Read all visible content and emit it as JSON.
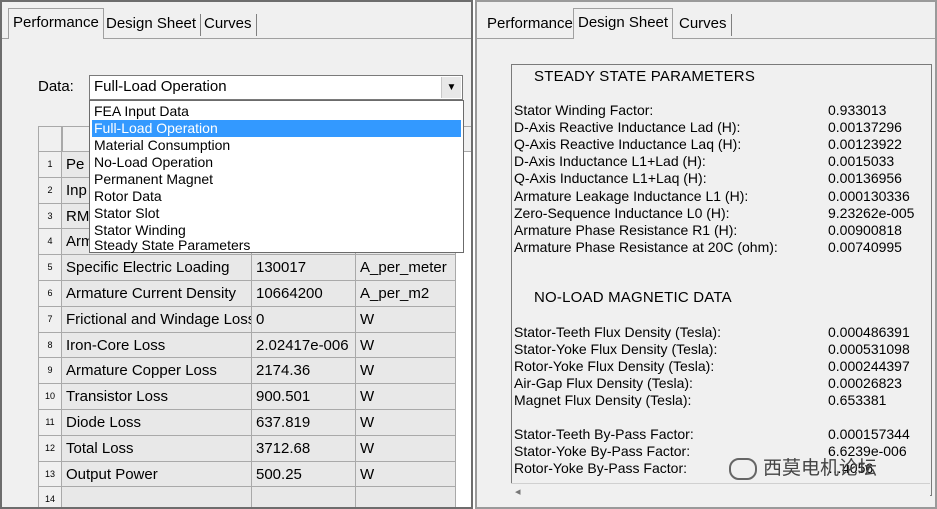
{
  "left": {
    "tabs": [
      "Performance",
      "Design Sheet",
      "Curves"
    ],
    "data_label": "Data:",
    "selected": "Full-Load Operation",
    "dropdown_options": [
      "FEA Input Data",
      "Full-Load Operation",
      "Material Consumption",
      "No-Load Operation",
      "Permanent Magnet",
      "Rotor Data",
      "Stator Slot",
      "Stator Winding",
      "Steady State Parameters"
    ],
    "hidden_rows": [
      {
        "num": "1",
        "name": "Pe"
      },
      {
        "num": "2",
        "name": "Inp"
      },
      {
        "num": "3",
        "name": "RM"
      },
      {
        "num": "4",
        "name": "Arm"
      }
    ],
    "rows": [
      {
        "num": "5",
        "name": "Specific Electric Loading",
        "value": "130017",
        "unit": "A_per_meter"
      },
      {
        "num": "6",
        "name": "Armature Current Density",
        "value": "10664200",
        "unit": "A_per_m2"
      },
      {
        "num": "7",
        "name": "Frictional and Windage Loss",
        "value": "0",
        "unit": "W"
      },
      {
        "num": "8",
        "name": "Iron-Core Loss",
        "value": "2.02417e-006",
        "unit": "W"
      },
      {
        "num": "9",
        "name": "Armature Copper Loss",
        "value": "2174.36",
        "unit": "W"
      },
      {
        "num": "10",
        "name": "Transistor Loss",
        "value": "900.501",
        "unit": "W"
      },
      {
        "num": "11",
        "name": "Diode Loss",
        "value": "637.819",
        "unit": "W"
      },
      {
        "num": "12",
        "name": "Total Loss",
        "value": "3712.68",
        "unit": "W"
      },
      {
        "num": "13",
        "name": "Output Power",
        "value": "500.25",
        "unit": "W"
      },
      {
        "num": "14",
        "name": "",
        "value": "",
        "unit": ""
      }
    ]
  },
  "right": {
    "tabs": [
      "Performance",
      "Design Sheet",
      "Curves"
    ],
    "steady_title": "STEADY STATE PARAMETERS",
    "steady": [
      {
        "name": "Stator Winding Factor:",
        "value": "0.933013"
      },
      {
        "name": "D-Axis Reactive Inductance Lad (H):",
        "value": "0.00137296"
      },
      {
        "name": "Q-Axis Reactive Inductance Laq (H):",
        "value": "0.00123922"
      },
      {
        "name": "D-Axis Inductance L1+Lad (H):",
        "value": "0.0015033"
      },
      {
        "name": "Q-Axis Inductance L1+Laq (H):",
        "value": "0.00136956"
      },
      {
        "name": "Armature Leakage Inductance L1 (H):",
        "value": "0.000130336"
      },
      {
        "name": "Zero-Sequence Inductance L0 (H):",
        "value": "9.23262e-005"
      },
      {
        "name": "Armature Phase Resistance R1 (H):",
        "value": "0.00900818"
      },
      {
        "name": "Armature Phase Resistance at 20C (ohm):",
        "value": "0.00740995"
      }
    ],
    "noload_title": "NO-LOAD MAGNETIC DATA",
    "noload": [
      {
        "name": "Stator-Teeth Flux Density (Tesla):",
        "value": "0.000486391"
      },
      {
        "name": "Stator-Yoke Flux Density (Tesla):",
        "value": "0.000531098"
      },
      {
        "name": "Rotor-Yoke Flux Density (Tesla):",
        "value": "0.000244397"
      },
      {
        "name": "Air-Gap Flux Density (Tesla):",
        "value": "0.00026823"
      },
      {
        "name": "Magnet Flux Density (Tesla):",
        "value": "0.653381"
      }
    ],
    "bypass": [
      {
        "name": "Stator-Teeth By-Pass Factor:",
        "value": "0.000157344"
      },
      {
        "name": "Stator-Yoke By-Pass Factor:",
        "value": "6.6239e-006"
      },
      {
        "name": "Rotor-Yoke By-Pass Factor:",
        "value": "…4056"
      }
    ],
    "watermark": "西莫电机论坛"
  },
  "colors": {
    "selection": "#3399ff",
    "cell": "#e8e8e8",
    "window": "#f0f0f0"
  }
}
